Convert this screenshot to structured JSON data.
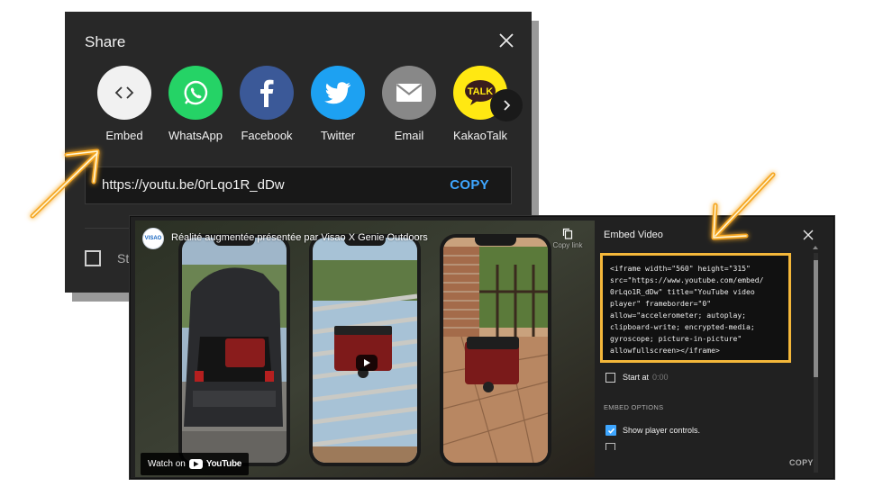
{
  "share_dialog": {
    "title": "Share",
    "items": [
      {
        "label": "Embed",
        "icon": "embed-code-icon",
        "color": "#f1f1f1"
      },
      {
        "label": "WhatsApp",
        "icon": "whatsapp-icon",
        "color": "#25d366"
      },
      {
        "label": "Facebook",
        "icon": "facebook-icon",
        "color": "#3b5998"
      },
      {
        "label": "Twitter",
        "icon": "twitter-icon",
        "color": "#1da1f2"
      },
      {
        "label": "Email",
        "icon": "email-icon",
        "color": "#888888"
      },
      {
        "label": "KakaoTalk",
        "icon": "kakaotalk-icon",
        "color": "#ffe812"
      }
    ],
    "kakao_text": "TALK",
    "url": "https://youtu.be/0rLqo1R_dDw",
    "copy_label": "COPY",
    "start_label": "St"
  },
  "embed_dialog": {
    "title": "Embed Video",
    "video_title": "Réalité augmentée présentée par Visao X Genie Outdoors",
    "channel_logo": "VISAO",
    "copy_link_label": "Copy link",
    "watch_on": "Watch on",
    "youtube": "YouTube",
    "embed_code": "<iframe width=\"560\" height=\"315\"\nsrc=\"https://www.youtube.com/embed/\n0rLqo1R_dDw\" title=\"YouTube video\nplayer\" frameborder=\"0\"\nallow=\"accelerometer; autoplay;\nclipboard-write; encrypted-media;\ngyroscope; picture-in-picture\"\nallowfullscreen></iframe>",
    "start_at_label": "Start at",
    "start_at_value": "0:00",
    "options_heading": "EMBED OPTIONS",
    "show_controls_label": "Show player controls.",
    "show_controls_checked": true,
    "copy_label": "COPY"
  },
  "accent_colors": {
    "highlight": "#f4b73a",
    "link_blue": "#3ea6ff"
  }
}
